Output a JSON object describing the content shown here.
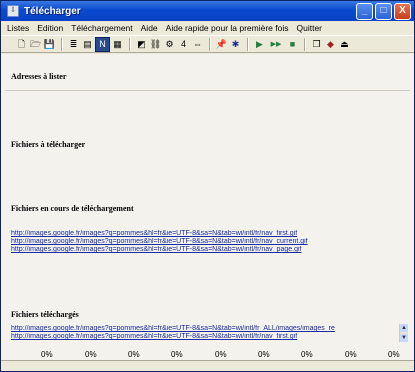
{
  "window": {
    "title": "Télécharger",
    "app_icon": "download-app-icon",
    "buttons": {
      "minimize": "_",
      "maximize": "□",
      "close": "X"
    }
  },
  "menu": [
    "Listes",
    "Edition",
    "Téléchargement",
    "Aide",
    "Aide rapide pour la première fois",
    "Quitter"
  ],
  "toolbar": {
    "icons": [
      {
        "name": "new-icon",
        "glyph": "🗋"
      },
      {
        "name": "open-icon",
        "glyph": "🗁"
      },
      {
        "name": "save-icon",
        "glyph": "💾"
      },
      {
        "name": "list-icon",
        "glyph": "≣"
      },
      {
        "name": "view-icon",
        "glyph": "▤"
      },
      {
        "name": "view-selected-icon",
        "glyph": "N"
      },
      {
        "name": "grid-icon",
        "glyph": "▦"
      },
      {
        "name": "image-icon",
        "glyph": "◩"
      },
      {
        "name": "link-icon",
        "glyph": "⛓"
      },
      {
        "name": "settings-icon",
        "glyph": "⚙"
      },
      {
        "name": "counter-value",
        "glyph": "4"
      },
      {
        "name": "nav-arrows-icon",
        "glyph": "⇔"
      },
      {
        "name": "pin-icon",
        "glyph": "📌"
      },
      {
        "name": "run-icon",
        "glyph": "✱"
      },
      {
        "name": "play-icon",
        "glyph": "▶"
      },
      {
        "name": "play-all-icon",
        "glyph": "▶▶"
      },
      {
        "name": "stop-icon",
        "glyph": "■"
      },
      {
        "name": "window-icon",
        "glyph": "❐"
      },
      {
        "name": "layers-icon",
        "glyph": "◆"
      },
      {
        "name": "exit-icon",
        "glyph": "⏏"
      }
    ]
  },
  "sections": {
    "addresses": "Adresses à lister",
    "files_to_download": "Fichiers à télécharger",
    "in_progress": "Fichiers en cours de téléchargement",
    "downloaded": "Fichiers téléchargés"
  },
  "in_progress_urls": [
    "http://images.google.fr/images?q=pommes&hl=fr&ie=UTF-8&sa=N&tab=wi/intl/fr/nav_first.gif",
    "http://images.google.fr/images?q=pommes&hl=fr&ie=UTF-8&sa=N&tab=wi/intl/fr/nav_current.gif",
    "http://images.google.fr/images?q=pommes&hl=fr&ie=UTF-8&sa=N&tab=wi/intl/fr/nav_page.gif"
  ],
  "downloaded_urls": [
    "http://images.google.fr/images?q=pommes&hl=fr&ie=UTF-8&sa=N&tab=wi/intl/fr_ALL/images/images_re",
    "http://images.google.fr/images?q=pommes&hl=fr&ie=UTF-8&sa=N&tab=wi/intl/fr/nav_first.gif"
  ],
  "progress": [
    "0%",
    "0%",
    "0%",
    "0%",
    "0%",
    "0%",
    "0%",
    "0%",
    "0%"
  ]
}
